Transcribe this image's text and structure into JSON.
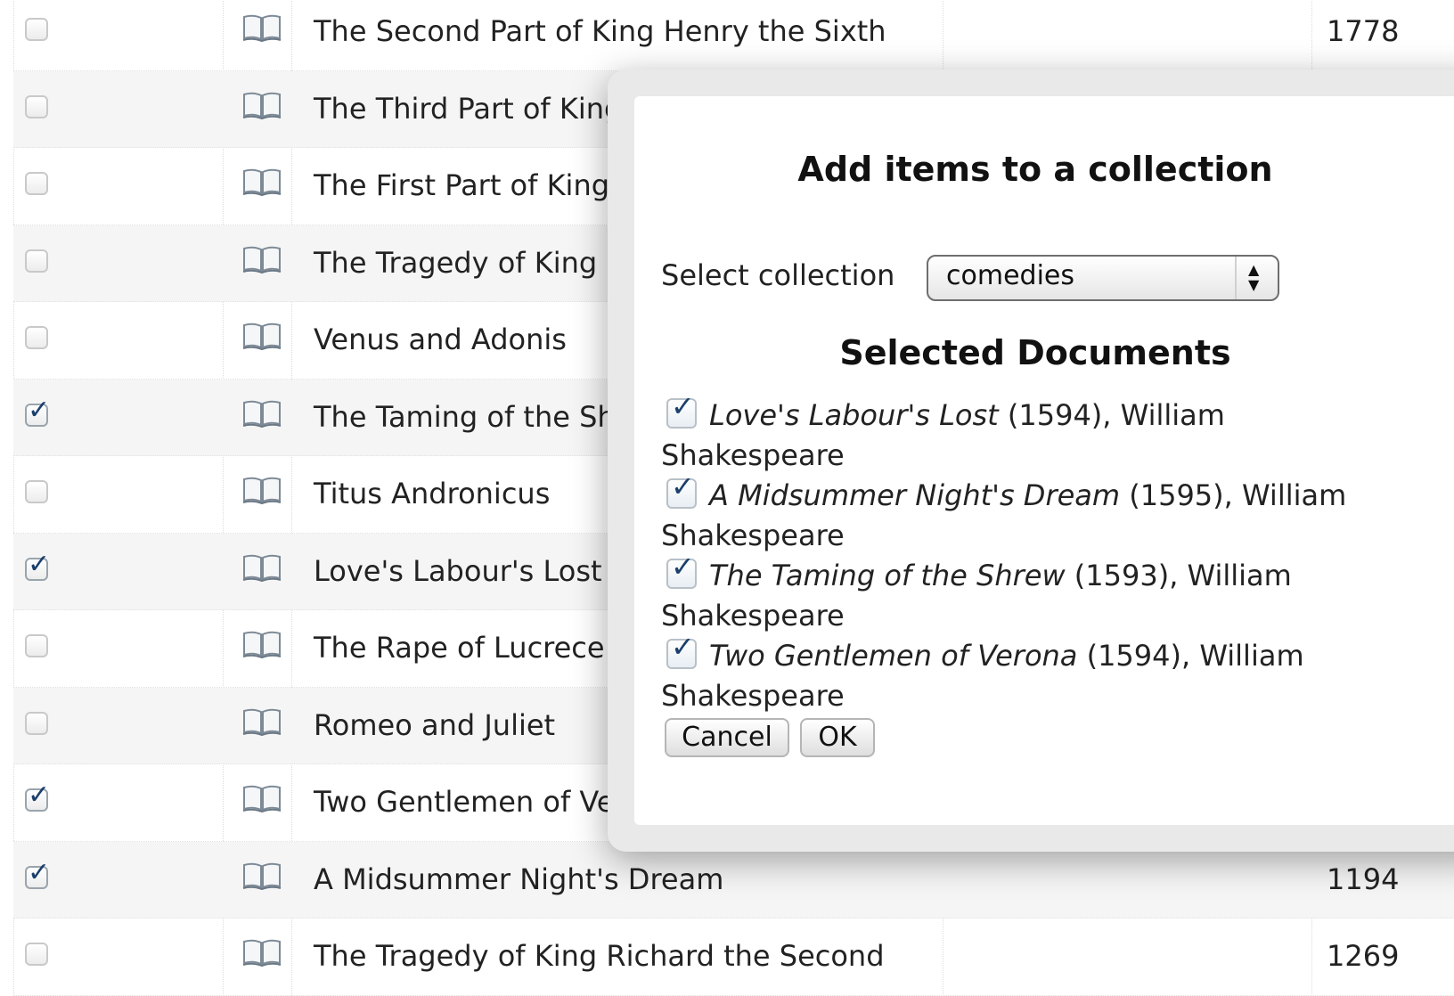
{
  "table": {
    "rows": [
      {
        "checked": false,
        "title": "The Second Part of King Henry the Sixth",
        "number": "1778"
      },
      {
        "checked": false,
        "title": "The Third Part of King Henry the Sixth",
        "number": ""
      },
      {
        "checked": false,
        "title": "The First Part of King Henry the Sixth",
        "number": ""
      },
      {
        "checked": false,
        "title": "The Tragedy of King Richard the Third",
        "number": ""
      },
      {
        "checked": false,
        "title": "Venus and Adonis",
        "number": ""
      },
      {
        "checked": true,
        "title": "The Taming of the Shrew",
        "number": ""
      },
      {
        "checked": false,
        "title": "Titus Andronicus",
        "number": ""
      },
      {
        "checked": true,
        "title": "Love's Labour's Lost",
        "number": ""
      },
      {
        "checked": false,
        "title": "The Rape of Lucrece",
        "number": ""
      },
      {
        "checked": false,
        "title": "Romeo and Juliet",
        "number": ""
      },
      {
        "checked": true,
        "title": "Two Gentlemen of Verona",
        "number": ""
      },
      {
        "checked": true,
        "title": "A Midsummer Night's Dream",
        "number": "1194"
      },
      {
        "checked": false,
        "title": "The Tragedy of King Richard the Second",
        "number": "1269"
      }
    ],
    "row_icon": "open-book-icon"
  },
  "dialog": {
    "title": "Add items to a collection",
    "select_label": "Select collection",
    "select_value": "comedies",
    "selected_heading": "Selected Documents",
    "documents": [
      {
        "checked": true,
        "title": "Love's Labour's Lost",
        "year": "(1594)",
        "author_line1": ", William",
        "author_line2": "Shakespeare"
      },
      {
        "checked": true,
        "title": "A Midsummer Night's Dream",
        "year": "(1595)",
        "author_line1": ", William",
        "author_line2": "Shakespeare"
      },
      {
        "checked": true,
        "title": "The Taming of the Shrew",
        "year": "(1593)",
        "author_line1": ", William",
        "author_line2": "Shakespeare"
      },
      {
        "checked": true,
        "title": "Two Gentlemen of Verona",
        "year": "(1594)",
        "author_line1": ", William",
        "author_line2": "Shakespeare"
      }
    ],
    "cancel_label": "Cancel",
    "ok_label": "OK"
  },
  "colors": {
    "checkmark": "#1b3f6b",
    "row_alt": "#f5f5f5",
    "dialog_frame": "#e9e9e9"
  }
}
